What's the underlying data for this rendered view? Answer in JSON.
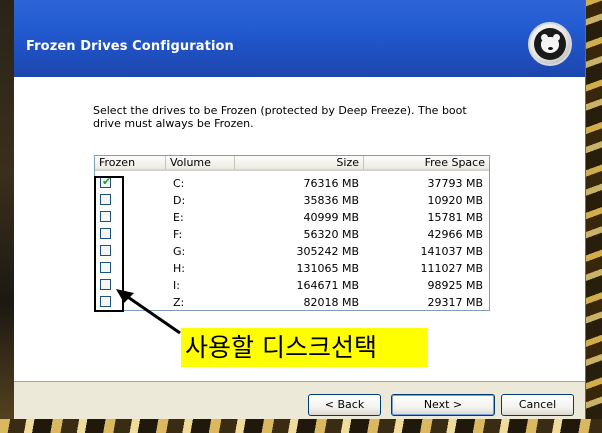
{
  "window": {
    "title": "Frozen Drives Configuration",
    "description": "Select the drives to be Frozen (protected by Deep Freeze). The boot drive must always be Frozen."
  },
  "table": {
    "columns": [
      "Frozen",
      "Volume",
      "Size",
      "Free Space"
    ],
    "rows": [
      {
        "checked": true,
        "volume": "C:",
        "size": "76316 MB",
        "free": "37793 MB"
      },
      {
        "checked": false,
        "volume": "D:",
        "size": "35836 MB",
        "free": "10920 MB"
      },
      {
        "checked": false,
        "volume": "E:",
        "size": "40999 MB",
        "free": "15781 MB"
      },
      {
        "checked": false,
        "volume": "F:",
        "size": "56320 MB",
        "free": "42966 MB"
      },
      {
        "checked": false,
        "volume": "G:",
        "size": "305242 MB",
        "free": "141037 MB"
      },
      {
        "checked": false,
        "volume": "H:",
        "size": "131065 MB",
        "free": "111027 MB"
      },
      {
        "checked": false,
        "volume": "I:",
        "size": "164671 MB",
        "free": "98925 MB"
      },
      {
        "checked": false,
        "volume": "Z:",
        "size": "82018 MB",
        "free": "29317 MB"
      }
    ]
  },
  "annotation": {
    "label": "사용할 디스크선택"
  },
  "buttons": {
    "back": "< Back",
    "next": "Next >",
    "cancel": "Cancel"
  },
  "icons": {
    "logo": "deep-freeze-polar-bear-icon",
    "checkmark": "checkmark-icon"
  }
}
